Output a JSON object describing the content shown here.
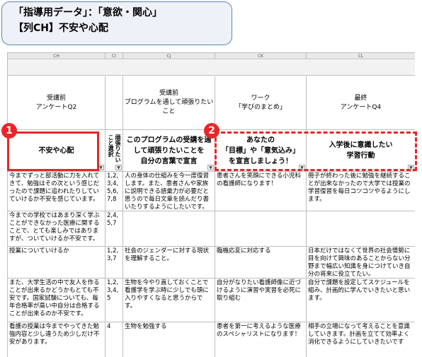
{
  "banner": {
    "line1": "「指導用データ」：「意欲・関心」",
    "line2": "【列CH】不安や心配"
  },
  "columns": [
    "CH",
    "CI",
    "CJ",
    "CK",
    "CL"
  ],
  "header_row1": {
    "ch": [
      "受講前",
      "アンケートQ2"
    ],
    "cj": [
      "受講前",
      "プログラムを通して頑張りたいこと"
    ],
    "ck": [
      "ワーク",
      "「学びのまとめ」"
    ],
    "cl": [
      "最終",
      "アンケートQ4"
    ]
  },
  "header_row2": {
    "ch": "不安や心配",
    "ci": "頑張りたいこと選択",
    "cj": [
      "このプログラムの受講を通",
      "して頑張りたいことを",
      "自分の言葉で宣言"
    ],
    "ck": [
      "あなたの",
      "「目標」や「意気込み」",
      "を宣言しましょう！"
    ],
    "cl": [
      "入学後に意識したい",
      "学習行動"
    ]
  },
  "dropdown_glyph": "▼",
  "badges": [
    "1",
    "2"
  ],
  "rows": [
    {
      "ch": "今までずっと部活動に力を入れてきて、勉強はその次という感じだったので課題に追われたりしていていけるか不安を感じています。",
      "ci": "1,2,3,4,5,6,7,8",
      "cj": "人の身体の仕組みを今一度復習します。また、患者さんや家族に説明できる語彙力が必要だと思うので毎日文章を読んだり書いたりするようにしたいです。",
      "ck": "患者さんを笑顔にできる小児科の看護師になります！",
      "cl": "冊子が終わった後に勉強を継続することが出来なかったので大学では授業の学習復習を毎日コツコツやるようにします。"
    },
    {
      "ch": "今までの学校ではあまり深く学ぶことができなかった医療に関することで、とても楽しみではありますが、ついていけるか不安です。",
      "ci": "2,4,5,7",
      "cj": "",
      "ck": "",
      "cl": ""
    },
    {
      "ch": "授業についていけるか",
      "ci": "1,2,3,7",
      "cj": "社会のジェンダーに対する現状を理解すること。",
      "ck": "臨機応変に対応する",
      "cl": "日本だけではなくて世界の社会情勢に目を向けて興味のあることからない分野まで幅広い知識を身につけていき自分の将来に役立てたい。"
    },
    {
      "ch": "また、大学生活の中で友人を作ることが出来るかどうかもとても不安です。国家試験についても、毎年合格率が高い中自分は合格することが出来るのか不安です。",
      "ci": "1,2,3,4,5",
      "cj": "生物を今やり直しておくことで看護学を学ぶ時に少しでも頭に入りやすくなると思うからです。",
      "ck": "自分がなりたい看護師像に近づけるように演習や実習を必死に取り組む",
      "cl": "自分で課題を設定してスケジュールを組み、計画的に学んでいきたいと思います。"
    },
    {
      "ch": "看護の授業は今までやってきた勉強内容と少し違うため少しだけ不安があります。",
      "ci": "4",
      "cj": "生物を勉強する",
      "ck": "患者を第一に考えるような医療のスペシャリストになります！",
      "cl": "相手の立場になって考えることを意識していきます。計画を立てて効率よく消化できるようにしていきたいです"
    }
  ]
}
